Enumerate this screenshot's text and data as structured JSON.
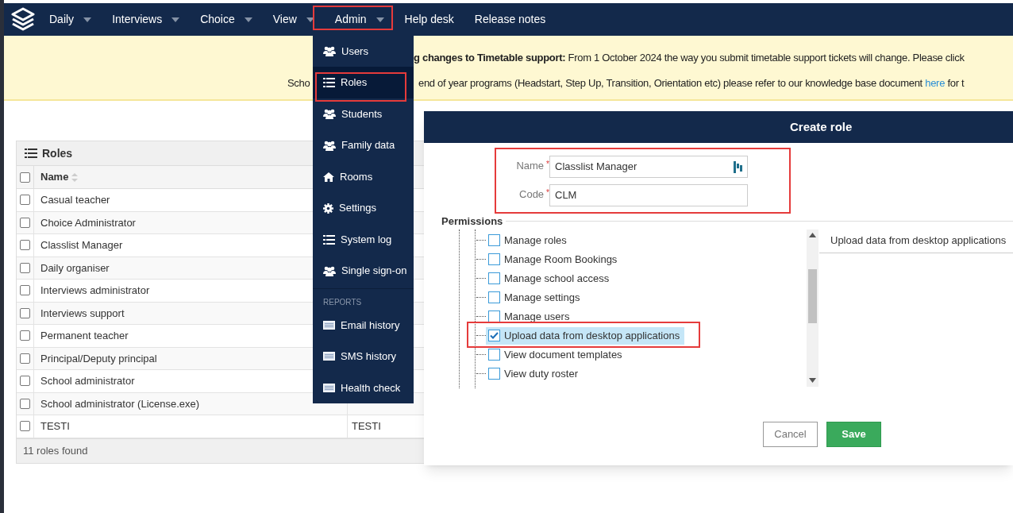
{
  "nav": {
    "items": [
      {
        "label": "Daily",
        "dropdown": true
      },
      {
        "label": "Interviews",
        "dropdown": true
      },
      {
        "label": "Choice",
        "dropdown": true
      },
      {
        "label": "View",
        "dropdown": true
      },
      {
        "label": "Admin",
        "dropdown": true
      },
      {
        "label": "Help desk",
        "dropdown": false
      },
      {
        "label": "Release notes",
        "dropdown": false
      }
    ]
  },
  "admin_menu": {
    "items": [
      {
        "label": "Users",
        "kind": "users",
        "selected": false
      },
      {
        "label": "Roles",
        "kind": "list",
        "selected": true
      },
      {
        "label": "Students",
        "kind": "users",
        "selected": false
      },
      {
        "label": "Family data",
        "kind": "users",
        "selected": false
      },
      {
        "label": "Rooms",
        "kind": "home",
        "selected": false
      },
      {
        "label": "Settings",
        "kind": "gear",
        "selected": false
      },
      {
        "label": "System log",
        "kind": "list",
        "selected": false
      },
      {
        "label": "Single sign-on",
        "kind": "users",
        "selected": false
      }
    ],
    "section": "REPORTS",
    "report_items": [
      {
        "label": "Email history",
        "kind": "report",
        "selected": false
      },
      {
        "label": "SMS history",
        "kind": "report",
        "selected": false
      },
      {
        "label": "Health check",
        "kind": "report",
        "selected": false
      }
    ]
  },
  "banner": {
    "line_1_bold": "g changes to Timetable support:",
    "line_1": "From 1 October 2024 the way you submit timetable support tickets will change. Please click",
    "line_2_start": "Scho",
    "line_2": "end of year programs (Headstart, Step Up, Transition, Orientation etc) please refer to our knowledge base document",
    "line_2_link": "here",
    "line_2_end": "for t"
  },
  "roles_table": {
    "title": "Roles",
    "columns": [
      "Name"
    ],
    "select_all_checked": false,
    "rows": [
      {
        "name": "Casual teacher",
        "checked": false
      },
      {
        "name": "Choice Administrator",
        "checked": false
      },
      {
        "name": "Classlist Manager",
        "checked": false
      },
      {
        "name": "Daily organiser",
        "checked": false
      },
      {
        "name": "Interviews administrator",
        "checked": false
      },
      {
        "name": "Interviews support",
        "checked": false
      },
      {
        "name": "Permanent teacher",
        "checked": false
      },
      {
        "name": "Principal/Deputy principal",
        "checked": false
      },
      {
        "name": "School administrator",
        "checked": false
      },
      {
        "name": "School administrator (License.exe)",
        "checked": false
      },
      {
        "name": "TESTI",
        "code": "TESTI",
        "checked": false
      }
    ],
    "footer": "11 roles found"
  },
  "create_role": {
    "title": "Create role",
    "fields": [
      {
        "label": "Name",
        "required_mark": "*",
        "value": "Classlist Manager"
      },
      {
        "label": "Code",
        "required_mark": "*",
        "value": "CLM"
      }
    ],
    "permissions_label": "Permissions",
    "permissions": [
      {
        "label": "Manage roles",
        "checked": false,
        "selected": false
      },
      {
        "label": "Manage Room Bookings",
        "checked": false,
        "selected": false
      },
      {
        "label": "Manage school access",
        "checked": false,
        "selected": false
      },
      {
        "label": "Manage settings",
        "checked": false,
        "selected": false
      },
      {
        "label": "Manage users",
        "checked": false,
        "selected": false
      },
      {
        "label": "Upload data from desktop applications",
        "checked": true,
        "selected": true
      },
      {
        "label": "View document templates",
        "checked": false,
        "selected": false
      },
      {
        "label": "View duty roster",
        "checked": false,
        "selected": false
      }
    ],
    "detail_title": "Upload data from desktop applications",
    "buttons": [
      {
        "label": "Cancel",
        "kind": "secondary"
      },
      {
        "label": "Save",
        "kind": "primary"
      }
    ]
  }
}
